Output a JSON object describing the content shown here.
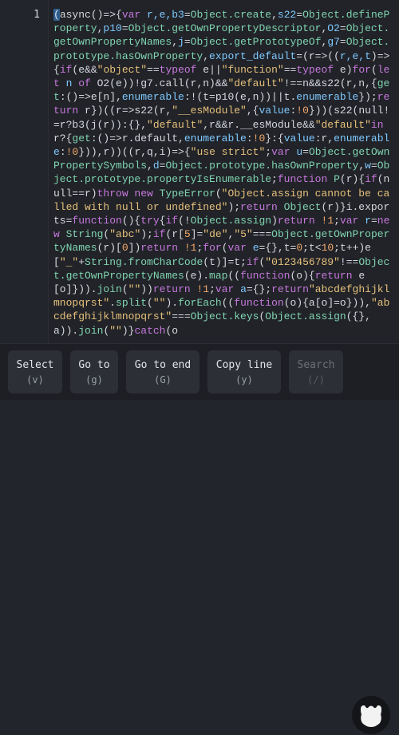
{
  "editor": {
    "line_number": "1",
    "cursor_char": "(",
    "tokens": [
      [
        "plain",
        "async()=>{"
      ],
      [
        "kw",
        "var "
      ],
      [
        "var",
        "r,e,b3"
      ],
      [
        "plain",
        "="
      ],
      [
        "fn",
        "Object.create"
      ],
      [
        "plain",
        ","
      ],
      [
        "var",
        "s22"
      ],
      [
        "plain",
        "="
      ],
      [
        "fn",
        "Object.defineProperty"
      ],
      [
        "plain",
        ","
      ],
      [
        "var",
        "p10"
      ],
      [
        "plain",
        "="
      ],
      [
        "fn",
        "Object.getOwnPropertyDescriptor"
      ],
      [
        "plain",
        ","
      ],
      [
        "var",
        "O2"
      ],
      [
        "plain",
        "="
      ],
      [
        "fn",
        "Object.getOwnPropertyNames"
      ],
      [
        "plain",
        ","
      ],
      [
        "var",
        "j"
      ],
      [
        "plain",
        "="
      ],
      [
        "fn",
        "Object.getPrototypeOf"
      ],
      [
        "plain",
        ","
      ],
      [
        "var",
        "g7"
      ],
      [
        "plain",
        "="
      ],
      [
        "fn",
        "Object.prototype.hasOwnProperty"
      ],
      [
        "plain",
        ","
      ],
      [
        "var",
        "export_default"
      ],
      [
        "plain",
        "=(r=>(("
      ],
      [
        "var",
        "r,e,t"
      ],
      [
        "plain",
        ")=>{"
      ],
      [
        "kw",
        "if"
      ],
      [
        "plain",
        "(e&&"
      ],
      [
        "str",
        "\"object\""
      ],
      [
        "plain",
        "=="
      ],
      [
        "kw",
        "typeof "
      ],
      [
        "plain",
        "e||"
      ],
      [
        "str",
        "\"function\""
      ],
      [
        "plain",
        "=="
      ],
      [
        "kw",
        "typeof "
      ],
      [
        "plain",
        "e)"
      ],
      [
        "kw",
        "for"
      ],
      [
        "plain",
        "("
      ],
      [
        "kw",
        "let "
      ],
      [
        "var",
        "n "
      ],
      [
        "kw",
        "of "
      ],
      [
        "plain",
        "O2(e))!g7.call(r,n)&&"
      ],
      [
        "str",
        "\"default\""
      ],
      [
        "plain",
        "!==n&&s22(r,n,{"
      ],
      [
        "fn",
        "get"
      ],
      [
        "plain",
        ":()=>e[n],"
      ],
      [
        "var",
        "enumerable"
      ],
      [
        "plain",
        ":!(t=p10(e,n))||t."
      ],
      [
        "var",
        "enumerable"
      ],
      [
        "plain",
        "});"
      ],
      [
        "kw",
        "return "
      ],
      [
        "plain",
        "r})((r=>s22(r,"
      ],
      [
        "str",
        "\"__esModule\""
      ],
      [
        "plain",
        ",{"
      ],
      [
        "var",
        "value"
      ],
      [
        "plain",
        ":"
      ],
      [
        "num",
        "!0"
      ],
      [
        "plain",
        "}))(s22(null!=r?b3(j(r)):{},"
      ],
      [
        "str",
        "\"default\""
      ],
      [
        "plain",
        ",r&&r.__esModule&&"
      ],
      [
        "str",
        "\"default\""
      ],
      [
        "kw",
        "in "
      ],
      [
        "plain",
        "r?{"
      ],
      [
        "fn",
        "get"
      ],
      [
        "plain",
        ":()=>r.default,"
      ],
      [
        "var",
        "enumerable"
      ],
      [
        "plain",
        ":"
      ],
      [
        "num",
        "!0"
      ],
      [
        "plain",
        "}:{"
      ],
      [
        "var",
        "value"
      ],
      [
        "plain",
        ":r,"
      ],
      [
        "var",
        "enumerable"
      ],
      [
        "plain",
        ":"
      ],
      [
        "num",
        "!0"
      ],
      [
        "plain",
        "})),r))((r,q,i)=>{"
      ],
      [
        "str",
        "\"use strict\""
      ],
      [
        "plain",
        ";"
      ],
      [
        "kw",
        "var "
      ],
      [
        "var",
        "u"
      ],
      [
        "plain",
        "="
      ],
      [
        "fn",
        "Object.getOwnPropertySymbols"
      ],
      [
        "plain",
        ","
      ],
      [
        "var",
        "d"
      ],
      [
        "plain",
        "="
      ],
      [
        "fn",
        "Object.prototype.hasOwnProperty"
      ],
      [
        "plain",
        ","
      ],
      [
        "var",
        "w"
      ],
      [
        "plain",
        "="
      ],
      [
        "fn",
        "Object.prototype.propertyIsEnumerable"
      ],
      [
        "plain",
        ";"
      ],
      [
        "kw",
        "function "
      ],
      [
        "fn",
        "P"
      ],
      [
        "plain",
        "(r){"
      ],
      [
        "kw",
        "if"
      ],
      [
        "plain",
        "(null==r)"
      ],
      [
        "kw",
        "throw new "
      ],
      [
        "fn",
        "TypeError"
      ],
      [
        "plain",
        "("
      ],
      [
        "str",
        "\"Object.assign cannot be called with null or undefined\""
      ],
      [
        "plain",
        ");"
      ],
      [
        "kw",
        "return "
      ],
      [
        "fn",
        "Object"
      ],
      [
        "plain",
        "(r)}i.exports="
      ],
      [
        "kw",
        "function"
      ],
      [
        "plain",
        "(){"
      ],
      [
        "kw",
        "try"
      ],
      [
        "plain",
        "{"
      ],
      [
        "kw",
        "if"
      ],
      [
        "plain",
        "(!"
      ],
      [
        "fn",
        "Object.assign"
      ],
      [
        "plain",
        ")"
      ],
      [
        "kw",
        "return "
      ],
      [
        "num",
        "!1"
      ],
      [
        "plain",
        ";"
      ],
      [
        "kw",
        "var "
      ],
      [
        "var",
        "r"
      ],
      [
        "plain",
        "="
      ],
      [
        "kw",
        "new "
      ],
      [
        "fn",
        "String"
      ],
      [
        "plain",
        "("
      ],
      [
        "str",
        "\"abc\""
      ],
      [
        "plain",
        ");"
      ],
      [
        "kw",
        "if"
      ],
      [
        "plain",
        "(r["
      ],
      [
        "num",
        "5"
      ],
      [
        "plain",
        "]="
      ],
      [
        "str",
        "\"de\""
      ],
      [
        "plain",
        ","
      ],
      [
        "str",
        "\"5\""
      ],
      [
        "plain",
        "==="
      ],
      [
        "fn",
        "Object.getOwnPropertyNames"
      ],
      [
        "plain",
        "(r)["
      ],
      [
        "num",
        "0"
      ],
      [
        "plain",
        "])"
      ],
      [
        "kw",
        "return "
      ],
      [
        "num",
        "!1"
      ],
      [
        "plain",
        ";"
      ],
      [
        "kw",
        "for"
      ],
      [
        "plain",
        "("
      ],
      [
        "kw",
        "var "
      ],
      [
        "var",
        "e"
      ],
      [
        "plain",
        "={},t="
      ],
      [
        "num",
        "0"
      ],
      [
        "plain",
        ";t<"
      ],
      [
        "num",
        "10"
      ],
      [
        "plain",
        ";t++)e["
      ],
      [
        "str",
        "\"_\""
      ],
      [
        "plain",
        "+"
      ],
      [
        "fn",
        "String.fromCharCode"
      ],
      [
        "plain",
        "(t)]=t;"
      ],
      [
        "kw",
        "if"
      ],
      [
        "plain",
        "("
      ],
      [
        "str",
        "\"0123456789\""
      ],
      [
        "plain",
        "!=="
      ],
      [
        "fn",
        "Object.getOwnPropertyNames"
      ],
      [
        "plain",
        "(e)."
      ],
      [
        "fn",
        "map"
      ],
      [
        "plain",
        "(("
      ],
      [
        "kw",
        "function"
      ],
      [
        "plain",
        "(o){"
      ],
      [
        "kw",
        "return "
      ],
      [
        "plain",
        "e[o]}))."
      ],
      [
        "fn",
        "join"
      ],
      [
        "plain",
        "("
      ],
      [
        "str",
        "\"\""
      ],
      [
        "plain",
        "))"
      ],
      [
        "kw",
        "return "
      ],
      [
        "num",
        "!1"
      ],
      [
        "plain",
        ";"
      ],
      [
        "kw",
        "var "
      ],
      [
        "var",
        "a"
      ],
      [
        "plain",
        "={};"
      ],
      [
        "kw",
        "return"
      ],
      [
        "str",
        "\"abcdefghijklmnopqrst\""
      ],
      [
        "plain",
        "."
      ],
      [
        "fn",
        "split"
      ],
      [
        "plain",
        "("
      ],
      [
        "str",
        "\"\""
      ],
      [
        "plain",
        ")."
      ],
      [
        "fn",
        "forEach"
      ],
      [
        "plain",
        "(("
      ],
      [
        "kw",
        "function"
      ],
      [
        "plain",
        "(o){a[o]=o})),"
      ],
      [
        "str",
        "\"abcdefghijklmnopqrst\""
      ],
      [
        "plain",
        "==="
      ],
      [
        "fn",
        "Object.keys"
      ],
      [
        "plain",
        "("
      ],
      [
        "fn",
        "Object.assign"
      ],
      [
        "plain",
        "({},a))."
      ],
      [
        "fn",
        "join"
      ],
      [
        "plain",
        "("
      ],
      [
        "str",
        "\"\""
      ],
      [
        "plain",
        ")}"
      ],
      [
        "kw",
        "catch"
      ],
      [
        "plain",
        "(o"
      ]
    ]
  },
  "toolbar": {
    "buttons": [
      {
        "label": "Select",
        "key": "(v)"
      },
      {
        "label": "Go to",
        "key": "(g)"
      },
      {
        "label": "Go to end",
        "key": "(G)"
      },
      {
        "label": "Copy line",
        "key": "(y)"
      },
      {
        "label": "Search",
        "key": "(/)"
      }
    ]
  },
  "colors": {
    "background": "#212328",
    "keyword": "#c678dd",
    "variable": "#7fc9ff",
    "function": "#80d4b0",
    "string": "#e6c07b",
    "number": "#f2a96b",
    "cursor": "#2e5e8e"
  },
  "icons": {
    "logo": "bear-paw-icon"
  }
}
